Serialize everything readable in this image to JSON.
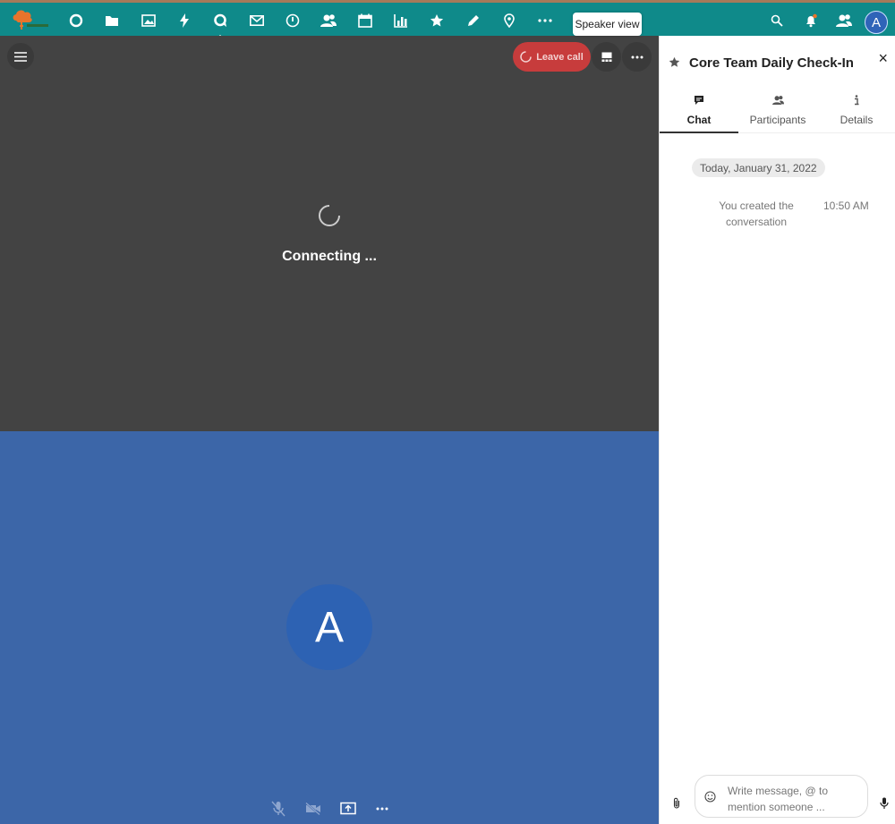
{
  "colors": {
    "header_bg": "#0f8a8a",
    "stage_bg": "#434343",
    "self_video_bg": "#3c66a8",
    "leave_call": "#c73c3c",
    "avatar": "#2d62b3"
  },
  "header": {
    "apps": [
      {
        "name": "dashboard-icon"
      },
      {
        "name": "files-icon"
      },
      {
        "name": "photos-icon"
      },
      {
        "name": "activity-icon"
      },
      {
        "name": "talk-icon",
        "active": true
      },
      {
        "name": "mail-icon"
      },
      {
        "name": "clock-icon"
      },
      {
        "name": "contacts-icon"
      },
      {
        "name": "calendar-icon"
      },
      {
        "name": "analytics-icon"
      },
      {
        "name": "favorites-icon"
      },
      {
        "name": "notes-icon"
      },
      {
        "name": "maps-icon"
      },
      {
        "name": "more-apps-icon"
      }
    ],
    "right_icons": [
      "search-icon",
      "notifications-icon",
      "contacts-menu-icon"
    ],
    "avatar_letter": "A"
  },
  "tooltip": {
    "text": "Speaker view"
  },
  "call": {
    "leave_label": "Leave call",
    "status": "Connecting ...",
    "self_avatar_letter": "A"
  },
  "sidebar": {
    "title": "Core Team Daily Check-In",
    "close": "×",
    "tabs": [
      {
        "label": "Chat",
        "icon": "chat-icon",
        "active": true
      },
      {
        "label": "Participants",
        "icon": "participants-icon"
      },
      {
        "label": "Details",
        "icon": "info-icon"
      }
    ],
    "date": "Today, January 31, 2022",
    "message": {
      "text": "You created the conversation",
      "time": "10:50 AM"
    },
    "composer": {
      "placeholder": "Write message, @ to mention someone ..."
    }
  }
}
